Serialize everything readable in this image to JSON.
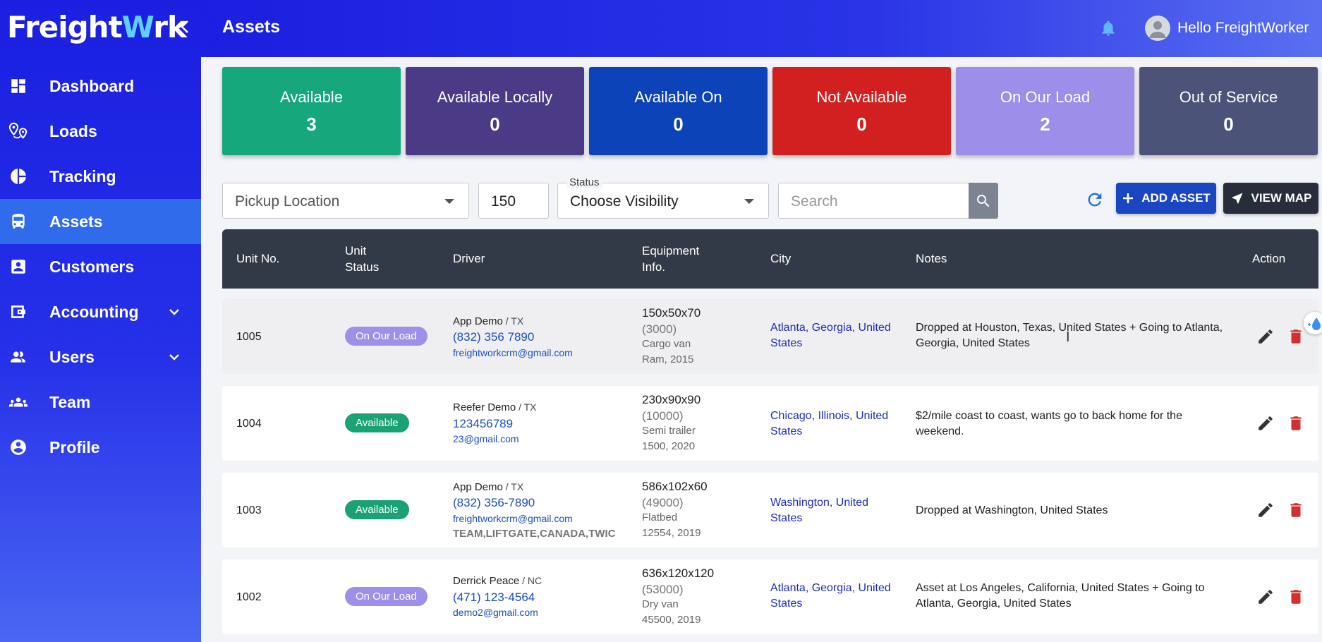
{
  "brand": {
    "name_prefix": "Freight",
    "name_w": "W",
    "name_suffix": "rk"
  },
  "header": {
    "title": "Assets",
    "greeting": "Hello FreightWorker"
  },
  "sidebar": {
    "items": [
      {
        "label": "Dashboard",
        "icon": "dashboard-icon"
      },
      {
        "label": "Loads",
        "icon": "location-pins-icon"
      },
      {
        "label": "Tracking",
        "icon": "pie-chart-icon"
      },
      {
        "label": "Assets",
        "icon": "bus-icon",
        "active": true
      },
      {
        "label": "Customers",
        "icon": "contact-card-icon"
      },
      {
        "label": "Accounting",
        "icon": "wallet-icon",
        "expandable": true
      },
      {
        "label": "Users",
        "icon": "users-icon",
        "expandable": true
      },
      {
        "label": "Team",
        "icon": "team-icon"
      },
      {
        "label": "Profile",
        "icon": "account-circle-icon"
      }
    ]
  },
  "cards": [
    {
      "title": "Available",
      "value": "3",
      "color": "#17a77c"
    },
    {
      "title": "Available Locally",
      "value": "0",
      "color": "#4b3a86"
    },
    {
      "title": "Available On",
      "value": "0",
      "color": "#0d43b9"
    },
    {
      "title": "Not Available",
      "value": "0",
      "color": "#d21f20"
    },
    {
      "title": "On Our Load",
      "value": "2",
      "color": "#9d8eea"
    },
    {
      "title": "Out of Service",
      "value": "0",
      "color": "#4b5478"
    }
  ],
  "filters": {
    "pickup_placeholder": "Pickup Location",
    "radius": "150",
    "status_legend": "Status",
    "status_value": "Choose Visibility",
    "search_placeholder": "Search"
  },
  "buttons": {
    "add_asset": "ADD ASSET",
    "view_map": "VIEW MAP"
  },
  "table": {
    "headers": {
      "unit": "Unit No.",
      "status_1": "Unit",
      "status_2": "Status",
      "driver": "Driver",
      "equip_1": "Equipment",
      "equip_2": "Info.",
      "city": "City",
      "notes": "Notes",
      "action": "Action"
    },
    "rows": [
      {
        "unit": "1005",
        "status": "On Our Load",
        "driver": "App Demo",
        "state": " / TX",
        "phone": "(832) 356 7890",
        "email": "freightworkcrm@gmail.com",
        "tags": "",
        "dims": "150x50x70",
        "weight": "(3000)",
        "type": "Cargo van",
        "model": "Ram, 2015",
        "city_1": "Atlanta, Georgia, United",
        "city_2": "States",
        "notes_1": "Dropped at Houston, Texas, United States + Going to Atlanta,",
        "notes_2": "Georgia, United States"
      },
      {
        "unit": "1004",
        "status": "Available",
        "driver": "Reefer Demo",
        "state": " / TX",
        "phone": "123456789",
        "email": "23@gmail.com",
        "tags": "",
        "dims": "230x90x90",
        "weight": "(10000)",
        "type": "Semi trailer",
        "model": "1500, 2020",
        "city_1": "Chicago, Illinois, United",
        "city_2": "States",
        "notes_1": "$2/mile coast to coast, wants go to back home for the",
        "notes_2": "weekend."
      },
      {
        "unit": "1003",
        "status": "Available",
        "driver": "App Demo",
        "state": " / TX",
        "phone": "(832) 356-7890",
        "email": "freightworkcrm@gmail.com",
        "tags": "TEAM,LIFTGATE,CANADA,TWIC",
        "dims": "586x102x60",
        "weight": "(49000)",
        "type": "Flatbed",
        "model": "12554, 2019",
        "city_1": "Washington, United",
        "city_2": "States",
        "notes_1": "Dropped at Washington, United States",
        "notes_2": ""
      },
      {
        "unit": "1002",
        "status": "On Our Load",
        "driver": "Derrick Peace",
        "state": " / NC",
        "phone": "(471) 123-4564",
        "email": "demo2@gmail.com",
        "tags": "",
        "dims": "636x120x120",
        "weight": "(53000)",
        "type": "Dry van",
        "model": "45500, 2019",
        "city_1": "Atlanta, Georgia, United",
        "city_2": "States",
        "notes_1": "Asset at Los Angeles, California, United States + Going to",
        "notes_2": "Atlanta, Georgia, United States"
      }
    ]
  }
}
